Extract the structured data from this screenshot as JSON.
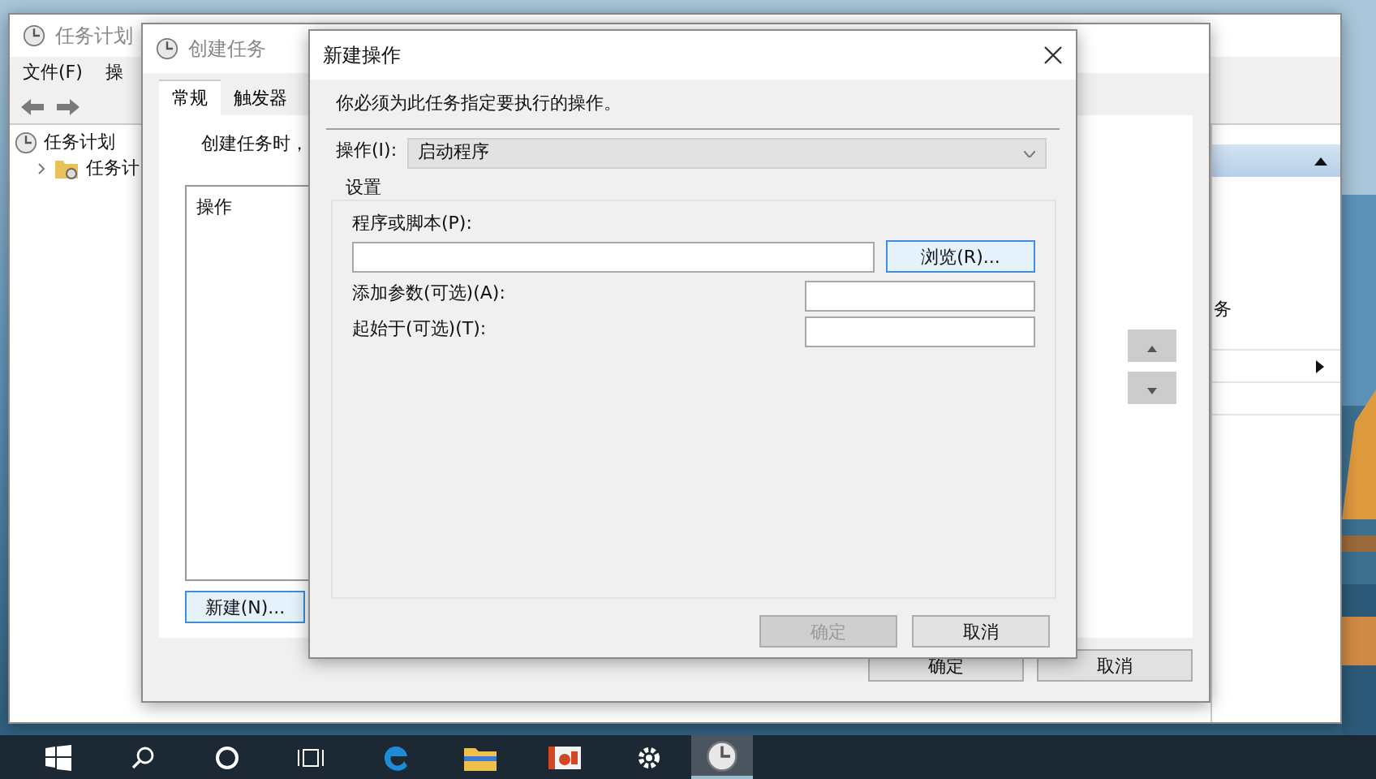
{
  "scheduler_window": {
    "title": "任务计划",
    "menu": [
      "文件(F)",
      "操"
    ],
    "tree": [
      {
        "label": "任务计划",
        "children": [
          {
            "label": "任务计",
            "expanded": false
          }
        ]
      }
    ],
    "actions_text": "务"
  },
  "create_task_window": {
    "title": "创建任务",
    "tabs": [
      {
        "label": "常规",
        "selected": true
      },
      {
        "label": "触发器",
        "selected": false
      }
    ],
    "hint": "创建任务时，",
    "list_header": "操作",
    "new_button": "新建(N)...",
    "buttons": [
      {
        "label": "确定",
        "disabled": false
      },
      {
        "label": "取消",
        "disabled": false
      }
    ]
  },
  "new_action_dialog": {
    "title": "新建操作",
    "instruction": "你必须为此任务指定要执行的操作。",
    "action_label": "操作(I):",
    "action_value": "启动程序",
    "group_title": "设置",
    "program_label": "程序或脚本(P):",
    "browse_button": "浏览(R)...",
    "args_label": "添加参数(可选)(A):",
    "start_label": "起始于(可选)(T):",
    "buttons": [
      {
        "label": "确定",
        "disabled": true
      },
      {
        "label": "取消",
        "disabled": false
      }
    ]
  },
  "taskbar": {
    "items": [
      {
        "kind": "start",
        "active": false
      },
      {
        "kind": "search",
        "active": false
      },
      {
        "kind": "cortana",
        "active": false
      },
      {
        "kind": "taskview",
        "active": false
      },
      {
        "kind": "edge",
        "active": false
      },
      {
        "kind": "explorer",
        "active": false
      },
      {
        "kind": "slides",
        "active": false
      },
      {
        "kind": "settings",
        "active": false
      },
      {
        "kind": "clock",
        "active": true
      }
    ]
  }
}
